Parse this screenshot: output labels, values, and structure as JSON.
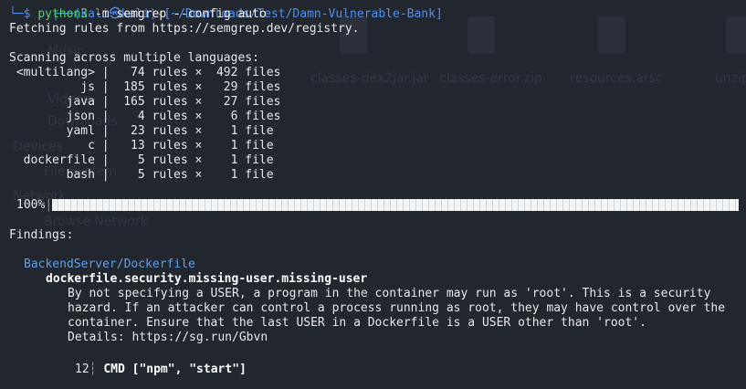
{
  "prompt": {
    "top_line": "(kali㉿kali)-[~/Downloads/Test/Damn-Vulnerable-Bank]",
    "symbol": "$",
    "cmd": "python3",
    "args": "-m semgrep --config auto"
  },
  "output": {
    "fetching": "Fetching rules from https://semgrep.dev/registry.",
    "scanning": "Scanning across multiple languages:",
    "languages": [
      {
        "lang": "<multilang>",
        "rules": "74",
        "files": "492",
        "unit": "files"
      },
      {
        "lang": "js",
        "rules": "185",
        "files": "29",
        "unit": "files"
      },
      {
        "lang": "java",
        "rules": "165",
        "files": "27",
        "unit": "files"
      },
      {
        "lang": "json",
        "rules": "4",
        "files": "6",
        "unit": "files"
      },
      {
        "lang": "yaml",
        "rules": "23",
        "files": "1",
        "unit": "file"
      },
      {
        "lang": "c",
        "rules": "13",
        "files": "1",
        "unit": "file"
      },
      {
        "lang": "dockerfile",
        "rules": "5",
        "files": "1",
        "unit": "file"
      },
      {
        "lang": "bash",
        "rules": "5",
        "files": "1",
        "unit": "file"
      }
    ],
    "progress_label": "100%",
    "progress_value": 1.0,
    "findings_label": "Findings:",
    "finding": {
      "file": "BackendServer/Dockerfile",
      "rule": "dockerfile.security.missing-user.missing-user",
      "message_lines": [
        "By not specifying a USER, a program in the container may run as 'root'. This is a security",
        "hazard. If an attacker can control a process running as root, they may have control over the",
        "container. Ensure that the last USER in a Dockerfile is a USER other than 'root'."
      ],
      "details": "Details: https://sg.run/Gbvn",
      "line_no": "12",
      "code": "CMD [\"npm\", \"start\"]"
    }
  },
  "background": {
    "items": [
      "Music",
      "Videos",
      "Downloads",
      "Devices",
      "File System",
      "Network",
      "Browse Network"
    ],
    "files": [
      "classes-dex2jar.jar",
      "classes-error.zip",
      "resources.arsc",
      "unzip"
    ]
  }
}
